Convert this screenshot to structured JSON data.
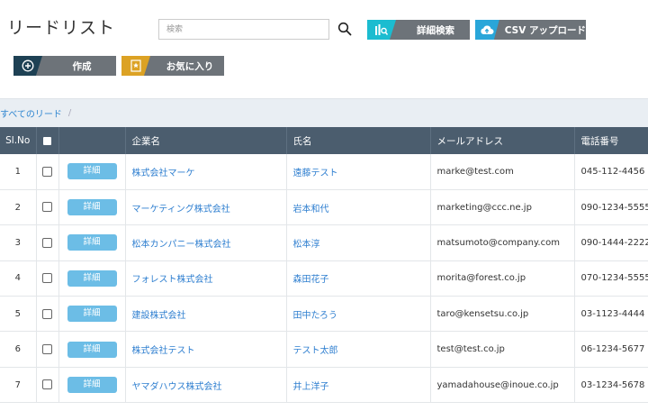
{
  "page_title": "リードリスト",
  "search": {
    "placeholder": "検索"
  },
  "buttons": {
    "advanced_search": "詳細検索",
    "csv_upload": "CSV アップロード",
    "create": "作成",
    "favorites": "お気に入り"
  },
  "breadcrumb": {
    "current": "すべてのリード",
    "separator": "/"
  },
  "table": {
    "headers": [
      "Sl.No",
      "",
      "",
      "企業名",
      "氏名",
      "メールアドレス",
      "電話番号"
    ],
    "detail_label": "詳細",
    "rows": [
      {
        "no": "1",
        "company": "株式会社マーケ",
        "name": "遠藤テスト",
        "email": "marke@test.com",
        "phone": "045-112-4456"
      },
      {
        "no": "2",
        "company": "マーケティング株式会社",
        "name": "岩本和代",
        "email": "marketing@ccc.ne.jp",
        "phone": "090-1234-5555"
      },
      {
        "no": "3",
        "company": "松本カンパニー株式会社",
        "name": "松本淳",
        "email": "matsumoto@company.com",
        "phone": "090-1444-2222"
      },
      {
        "no": "4",
        "company": "フォレスト株式会社",
        "name": "森田花子",
        "email": "morita@forest.co.jp",
        "phone": "070-1234-5555"
      },
      {
        "no": "5",
        "company": "建設株式会社",
        "name": "田中たろう",
        "email": "taro@kensetsu.co.jp",
        "phone": "03-1123-4444"
      },
      {
        "no": "6",
        "company": "株式会社テスト",
        "name": "テスト太郎",
        "email": "test@test.co.jp",
        "phone": "06-1234-5677"
      },
      {
        "no": "7",
        "company": "ヤマダハウス株式会社",
        "name": "井上洋子",
        "email": "yamadahouse@inoue.co.jp",
        "phone": "03-1234-5678"
      }
    ]
  }
}
